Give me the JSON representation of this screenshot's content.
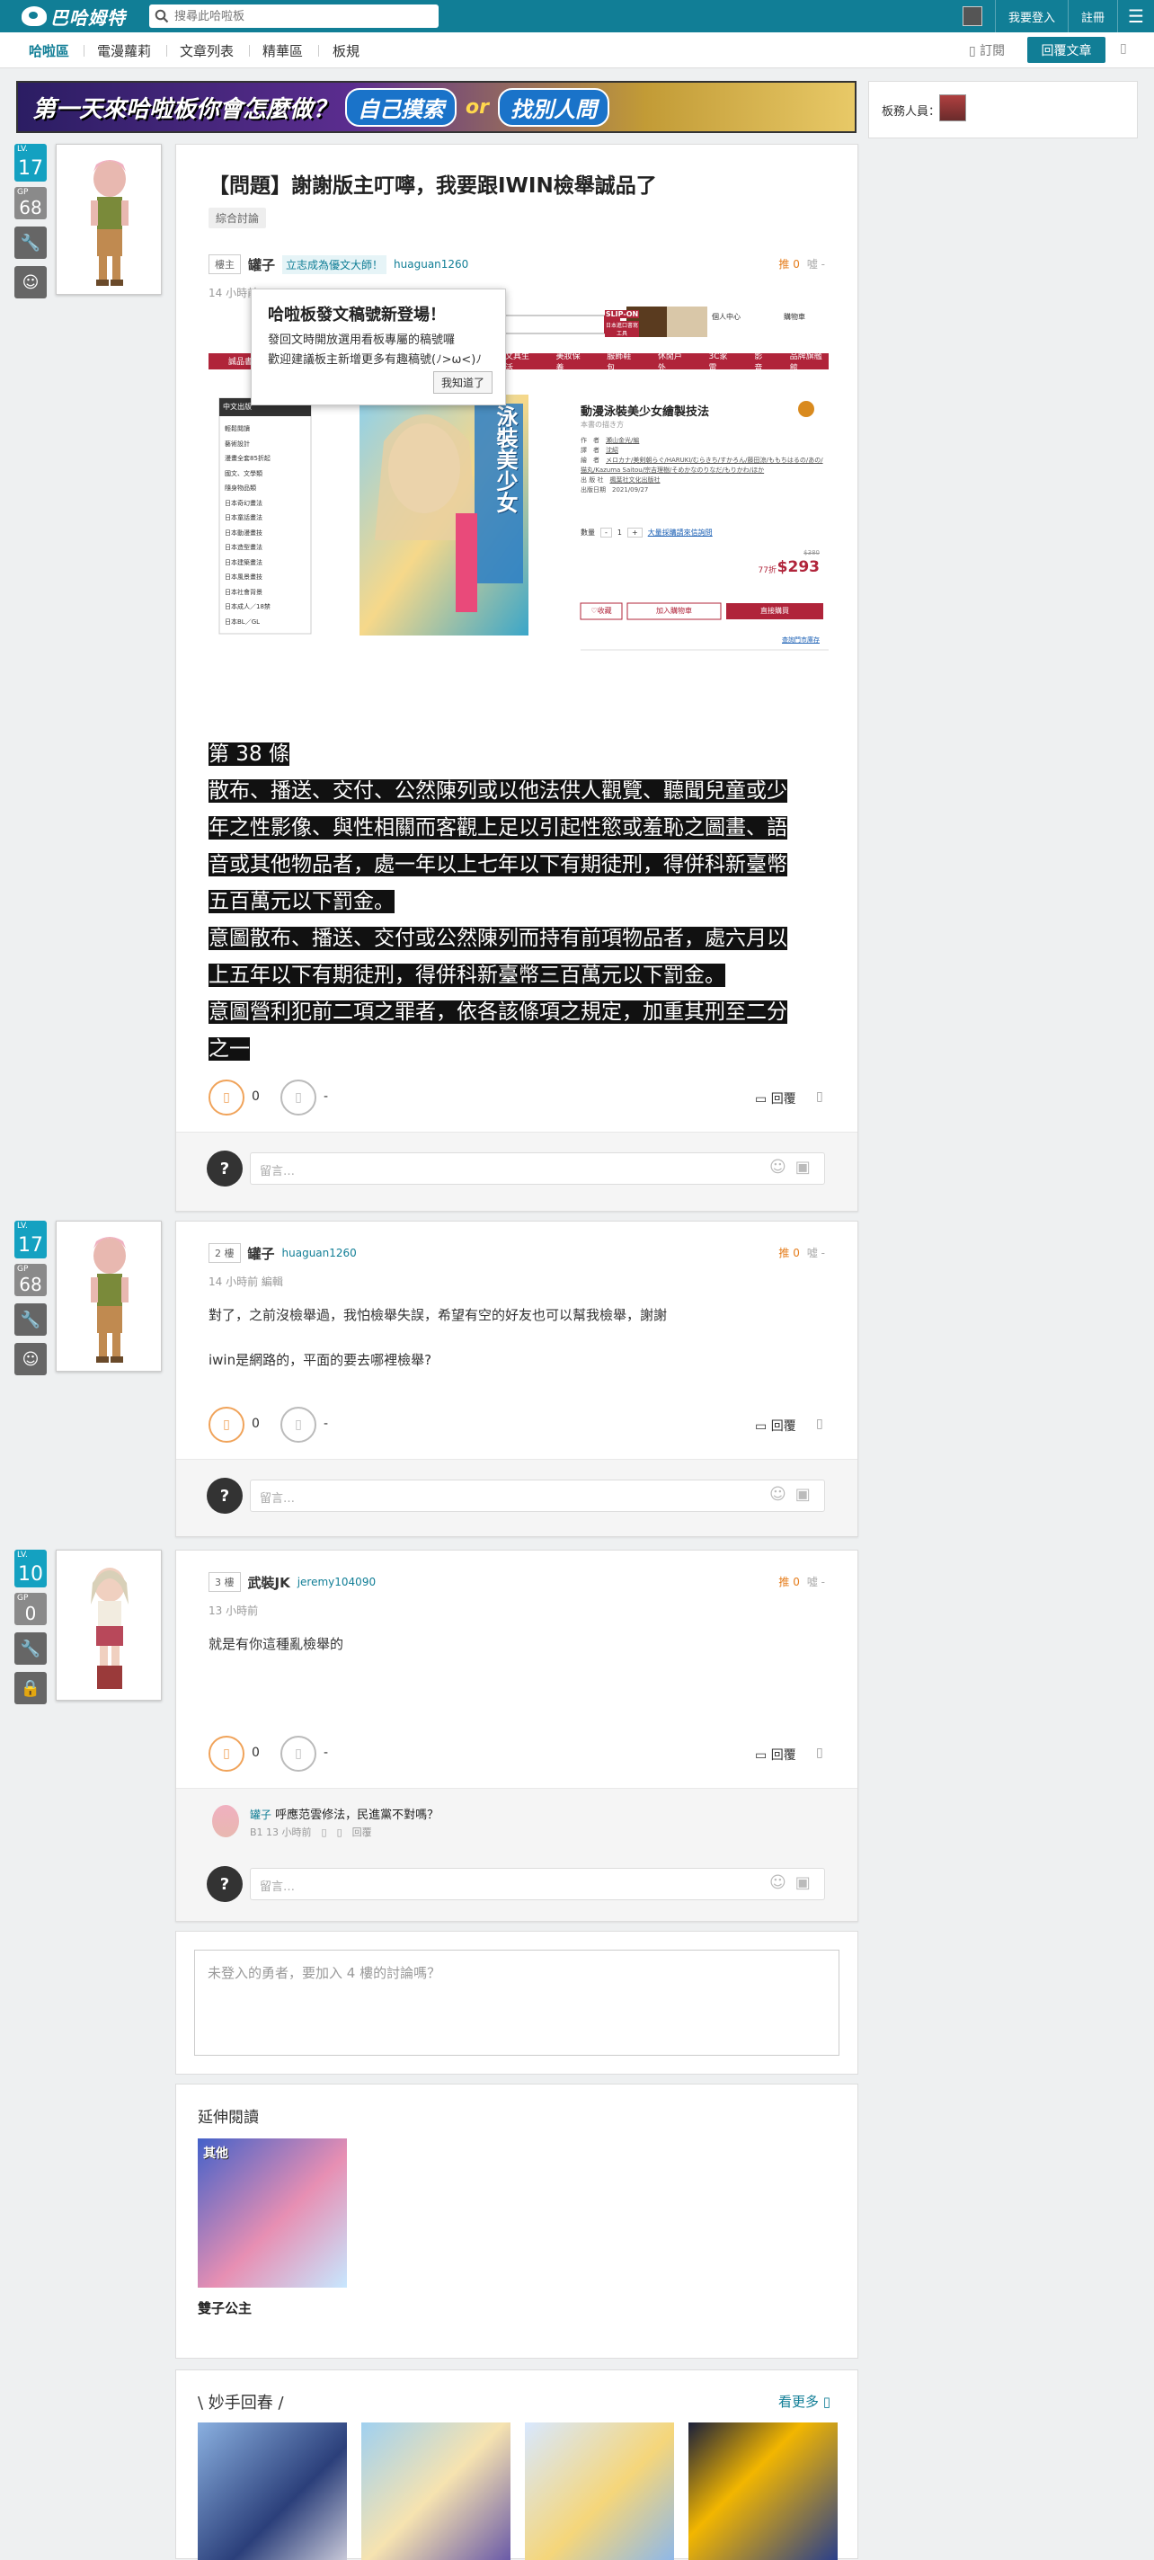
{
  "topbar": {
    "search_placeholder": "搜尋此哈啦板",
    "login": "我要登入",
    "register": "註冊",
    "menu_icon": "hamburger-icon",
    "search_icon": "search-icon",
    "brand_color": "#117e96"
  },
  "subnav": {
    "items": [
      "哈啦區",
      "電漫蘿莉",
      "文章列表",
      "精華區",
      "板規"
    ],
    "subscribe": "訂閱",
    "reply": "回覆文章"
  },
  "banner": {
    "text1": "第一天來哈啦板你會怎麼做？",
    "btn1": "自己摸索",
    "or": "or",
    "btn2": "找別人問"
  },
  "side": {
    "moderators_label": "板務人員："
  },
  "post1": {
    "title": "【問題】謝謝版主叮嚀，我要跟IWIN檢舉誠品了",
    "tag": "綜合討論",
    "floor": "樓主",
    "author": "罐子",
    "author_title": "立志成為優文大師！",
    "author_id": "huaguan1260",
    "time": "14 小時前",
    "gp": "推 0",
    "bp": "噓 -",
    "level": "17",
    "gp_points": "68",
    "lv_label": "LV.",
    "gp_label": "GP",
    "law_lines": [
      "第 38 條",
      "散布、播送、交付、公然陳列或以他法供人觀覽、聽聞兒童或少",
      "年之性影像、與性相關而客觀上足以引起性慾或羞恥之圖畫、語",
      "音或其他物品者，處一年以上七年以下有期徒刑，得併科新臺幣",
      "五百萬元以下罰金。",
      "意圖散布、播送、交付或公然陳列而持有前項物品者，處六月以",
      "上五年以下有期徒刑，得併科新臺幣三百萬元以下罰金。",
      "意圖營利犯前二項之罪者，依各該條項之規定，加重其刑至二分",
      "之一"
    ],
    "gp_count": "0",
    "bp_count": "-",
    "reply": "回覆",
    "comment_placeholder": "留言…"
  },
  "popup": {
    "title": "哈啦板發文稿號新登場！",
    "line1": "發回文時開放選用看板專屬的稿號囉",
    "line2": "歡迎建議板主新增更多有趣稿號(ﾉ>ω<)ﾉ",
    "button": "我知道了"
  },
  "product": {
    "slip_on": "SLIP-ON",
    "slip_sub": "日本進口書寫工具",
    "title": "動漫泳裝美少女繪製技法",
    "cover_text": "泳裝美少女",
    "subtitle": "本書の描き方",
    "info_rows": [
      [
        "作　者",
        "瀬山金光/編"
      ],
      [
        "譯　者",
        "沈紹"
      ],
      [
        "繪　者",
        "メロカナ/美剣朝らぐ/HARUKI/むらきち/すかろん/藤田涼/ももちはるの/あの/猫丸/Kazuma Saitou/宗吉理樹/そめかなのりなだ/もりかわ/ほか"
      ],
      [
        "出 版 社",
        "楓葉社文化出版社"
      ],
      [
        "出版日期",
        "2021/09/27"
      ]
    ],
    "qty_label": "數量",
    "qty": "1",
    "stock_note": "大量採購請來信詢問",
    "list_price": "$380",
    "discount": "77折",
    "price": "$293",
    "btn_fav": "收藏",
    "btn_cart": "加入購物車",
    "btn_buy": "直接購買",
    "pay_note": "查詢門市庫存",
    "sidebar_title": "中文出版",
    "sidebar_items": [
      "輕鬆閱讀",
      "藝術設計",
      "漫畫全套85折起",
      "國文、文學類",
      "隨身物品類",
      "日本奇幻畫法",
      "日本童話畫法",
      "日本動漫畫技",
      "日本造型畫法",
      "日本建築畫法",
      "日本風景畫技",
      "日本社會背景",
      "日本成人／18禁",
      "日本BL／GL"
    ],
    "nav_items": [
      "誠品書店",
      "文具生活",
      "美妝保養",
      "服飾鞋包",
      "休閒戶外",
      "3C家電",
      "影音",
      "品牌旗艦館"
    ],
    "account": "個人中心",
    "cart": "購物車"
  },
  "post2": {
    "floor": "2 樓",
    "author": "罐子",
    "author_id": "huaguan1260",
    "time": "14 小時前 編輯",
    "gp": "推 0",
    "bp": "噓 -",
    "level": "17",
    "gp_points": "68",
    "lines": [
      "對了，之前沒檢舉過，我怕檢舉失誤，希望有空的好友也可以幫我檢舉，謝謝",
      "iwin是網路的，平面的要去哪裡檢舉?"
    ],
    "gp_count": "0",
    "bp_count": "-",
    "reply": "回覆",
    "comment_placeholder": "留言…"
  },
  "post3": {
    "floor": "3 樓",
    "author": "武裝JK",
    "author_id": "jeremy104090",
    "time": "13 小時前",
    "gp": "推 0",
    "bp": "噓 -",
    "level": "10",
    "gp_points": "0",
    "text": "就是有你這種亂檢舉的",
    "gp_count": "0",
    "bp_count": "-",
    "reply": "回覆",
    "comment": {
      "author": "罐子",
      "text": "呼應范雲修法，民進黨不對嗎？",
      "meta": "B1 13 小時前",
      "reply": "回覆"
    },
    "comment_placeholder": "留言…"
  },
  "guest": {
    "placeholder": "未登入的勇者，要加入 4 樓的討論嗎？"
  },
  "extended": {
    "title": "延伸閱讀",
    "item_tag": "其他",
    "item_caption": "雙子公主"
  },
  "recommend": {
    "title": "\\ 妙手回春 /",
    "more": "看更多"
  }
}
